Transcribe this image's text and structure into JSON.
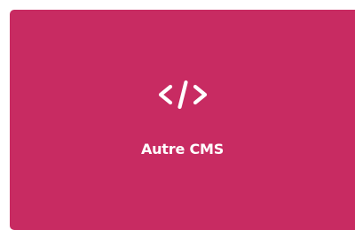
{
  "card": {
    "label": "Autre CMS",
    "icon": "code-icon",
    "background_color": "#c82b62",
    "text_color": "#ffffff"
  }
}
